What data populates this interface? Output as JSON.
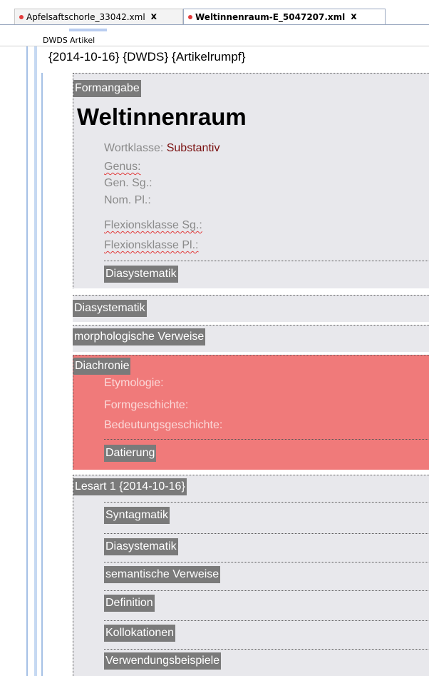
{
  "tabs": [
    {
      "label": "Apfelsaftschorle_33042.xml",
      "active": false
    },
    {
      "label": "Weltinnenraum-E_5047207.xml",
      "active": true
    }
  ],
  "close_glyph": "x",
  "modes": [
    "DWDS",
    "Artikel"
  ],
  "article": {
    "header": "{2014-10-16} {DWDS} {Artikelrumpf}",
    "formangabe": {
      "label": "Formangabe",
      "lemma": "Weltinnenraum",
      "wortklasse_label": "Wortklasse:",
      "wortklasse_value": "Substantiv",
      "fields": [
        "Genus:",
        "Gen. Sg.:",
        "Nom. Pl.:",
        "Flexionsklasse Sg.:",
        "Flexionsklasse Pl.:"
      ],
      "diasystematik": "Diasystematik"
    },
    "diasystematik": "Diasystematik",
    "morph_verweise": "morphologische Verweise",
    "diachronie": {
      "label": "Diachronie",
      "fields": [
        "Etymologie:",
        "Formgeschichte:",
        "Bedeutungsgeschichte:"
      ],
      "datierung": "Datierung"
    },
    "lesart": {
      "label": "Lesart 1 {2014-10-16}",
      "items": [
        "Syntagmatik",
        "Diasystematik",
        "semantische Verweise",
        "Definition",
        "Kollokationen",
        "Verwendungsbeispiele"
      ]
    }
  },
  "colors": {
    "label_bg": "#7a7a7a",
    "section_bg": "#e8e8ec",
    "diachronie_bg": "#f07a7a",
    "value_color": "#7a1010",
    "rail": "#a6c1e6",
    "modified_dot": "#e23b3b"
  }
}
